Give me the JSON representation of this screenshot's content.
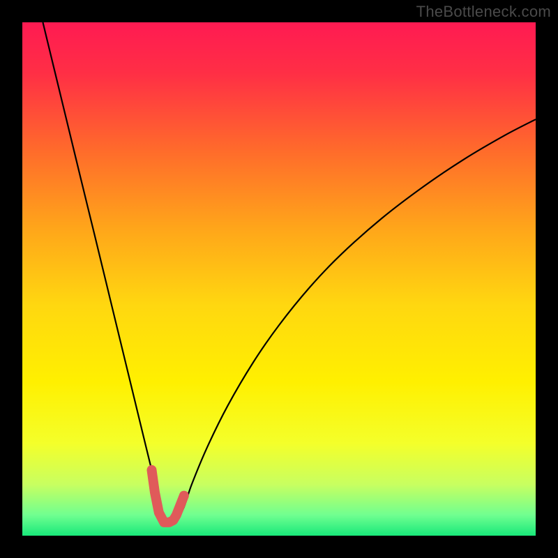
{
  "watermark": "TheBottleneck.com",
  "chart_data": {
    "type": "line",
    "title": "",
    "xlabel": "",
    "ylabel": "",
    "xlim": [
      0,
      100
    ],
    "ylim": [
      0,
      100
    ],
    "grid": false,
    "legend": false,
    "gradient_stops": [
      {
        "offset": 0.0,
        "color": "#ff1a52"
      },
      {
        "offset": 0.1,
        "color": "#ff2f45"
      },
      {
        "offset": 0.25,
        "color": "#ff6b2b"
      },
      {
        "offset": 0.4,
        "color": "#ffa51a"
      },
      {
        "offset": 0.55,
        "color": "#ffd710"
      },
      {
        "offset": 0.7,
        "color": "#fff000"
      },
      {
        "offset": 0.82,
        "color": "#f4ff2a"
      },
      {
        "offset": 0.9,
        "color": "#c8ff60"
      },
      {
        "offset": 0.96,
        "color": "#70ff90"
      },
      {
        "offset": 1.0,
        "color": "#18e87a"
      }
    ],
    "series": [
      {
        "name": "response-curve",
        "stroke": "#000000",
        "stroke_width": 2.2,
        "x": [
          4.0,
          6.5,
          9.0,
          11.5,
          14.0,
          16.5,
          19.0,
          21.5,
          24.0,
          25.2,
          26.0,
          26.8,
          27.6,
          28.4,
          29.2,
          30.0,
          31.5,
          33.0,
          36.0,
          40.0,
          45.0,
          50.0,
          56.0,
          62.0,
          70.0,
          78.0,
          86.0,
          94.0,
          100.0
        ],
        "y": [
          100.0,
          89.7,
          79.4,
          69.1,
          58.9,
          48.6,
          38.3,
          28.0,
          17.7,
          12.8,
          9.5,
          6.3,
          3.1,
          2.5,
          2.5,
          2.8,
          5.6,
          10.0,
          17.2,
          25.3,
          33.8,
          41.0,
          48.4,
          54.7,
          61.8,
          67.9,
          73.3,
          78.0,
          81.1
        ]
      },
      {
        "name": "valley-highlight",
        "stroke": "#e05a5a",
        "stroke_width": 14,
        "x": [
          25.2,
          25.8,
          26.6,
          27.6,
          28.6,
          29.4,
          30.0,
          31.5
        ],
        "y": [
          12.8,
          8.5,
          4.5,
          2.6,
          2.6,
          3.0,
          4.0,
          7.8
        ]
      }
    ],
    "annotations": []
  }
}
